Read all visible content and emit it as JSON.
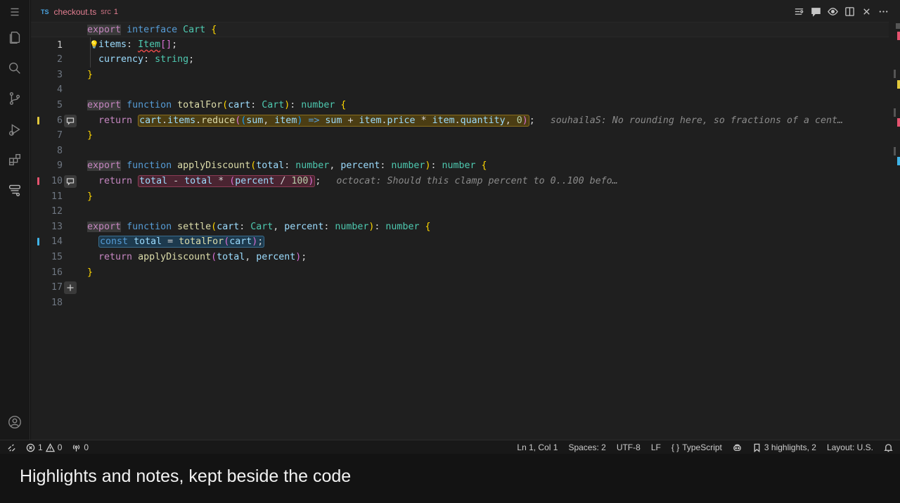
{
  "tab": {
    "language_badge": "TS",
    "file_name": "checkout.ts",
    "folder": "src",
    "problem_count": "1"
  },
  "activity_bar": [
    "explorer-icon",
    "search-icon",
    "source-control-icon",
    "run-debug-icon",
    "extensions-icon",
    "highlights-icon",
    "account-icon"
  ],
  "tab_actions": [
    "highlights-list-icon",
    "comments-icon",
    "preview-icon",
    "split-editor-icon",
    "close-icon",
    "more-actions-icon"
  ],
  "lines": {
    "n1": "1",
    "n2": "2",
    "n3": "3",
    "n4": "4",
    "n5": "5",
    "n6": "6",
    "n7": "7",
    "n8": "8",
    "n9": "9",
    "n10": "10",
    "n11": "11",
    "n12": "12",
    "n13": "13",
    "n14": "14",
    "n15": "15",
    "n16": "16",
    "n17": "17",
    "n18": "18"
  },
  "notes": {
    "line7": "souhailaS: No rounding here, so fractions of a cent…",
    "line11": "octocat: Should this clamp percent to 0..100 befo…"
  },
  "highlight_colors": {
    "yellow": "#e2c93b",
    "red": "#e5536f",
    "blue": "#3fb4e8"
  },
  "status": {
    "errors": "1",
    "warnings": "0",
    "ports": "0",
    "cursor": "Ln 1, Col 1",
    "spaces": "Spaces: 2",
    "encoding": "UTF-8",
    "eol": "LF",
    "language": "TypeScript",
    "highlights": "3 highlights, 2",
    "layout": "Layout: U.S."
  },
  "caption": "Highlights and notes, kept beside the code"
}
